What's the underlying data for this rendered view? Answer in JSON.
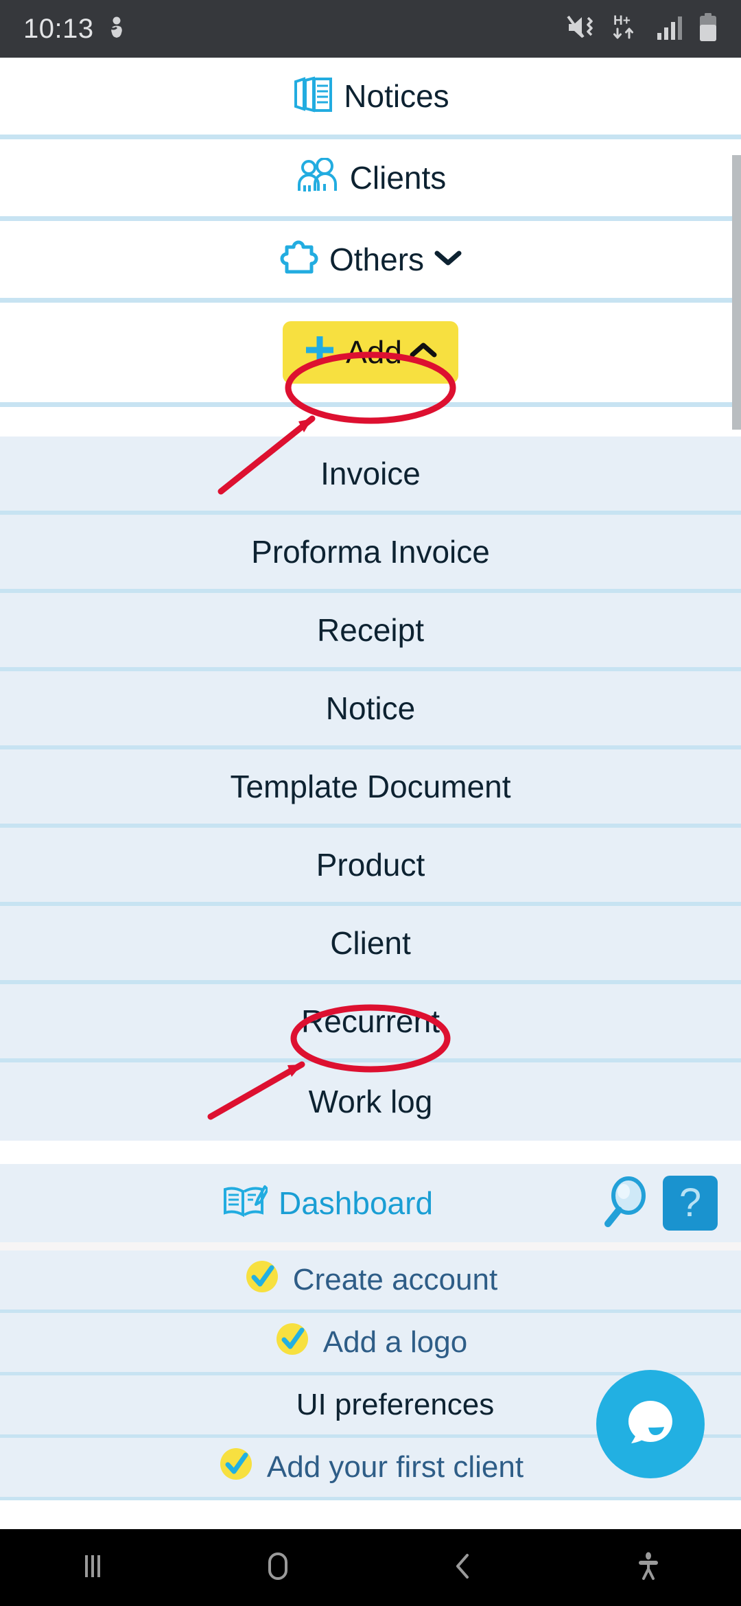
{
  "status_bar": {
    "time": "10:13",
    "left_icons": [
      "do-not-disturb-person-icon"
    ],
    "right_icons": [
      "mute-vibrate-icon",
      "h-plus-data-icon",
      "signal-bars-icon",
      "battery-icon"
    ],
    "background_color": "#36383c",
    "text_color": "#e3e4e6"
  },
  "top_nav": {
    "items": [
      {
        "label": "Notices",
        "icon": "stacked-documents-icon",
        "has_chevron": false
      },
      {
        "label": "Clients",
        "icon": "people-group-icon",
        "has_chevron": false
      },
      {
        "label": "Others",
        "icon": "puzzle-piece-icon",
        "has_chevron": true,
        "chevron": "chevron-down-icon"
      }
    ],
    "add_button": {
      "label": "Add",
      "icon": "plus-icon",
      "chevron": "chevron-up-icon",
      "highlight_color": "#f7e040",
      "expanded": true
    }
  },
  "dropdown": {
    "items": [
      {
        "label": "Invoice"
      },
      {
        "label": "Proforma Invoice"
      },
      {
        "label": "Receipt"
      },
      {
        "label": "Notice"
      },
      {
        "label": "Template Document"
      },
      {
        "label": "Product"
      },
      {
        "label": "Client"
      },
      {
        "label": "Recurrent"
      },
      {
        "label": "Work log"
      }
    ],
    "background_color": "#e7eff7",
    "separator_color": "#c7e3f2"
  },
  "dashboard_bar": {
    "label": "Dashboard",
    "icon": "open-book-pencil-icon",
    "label_color": "#1a9ed4",
    "search_icon": "magnifier-icon",
    "help_label": "?",
    "help_color": "#1a93cf"
  },
  "checklist": {
    "items": [
      {
        "label": "Create account",
        "checked": true
      },
      {
        "label": "Add a logo",
        "checked": true
      },
      {
        "label": "UI preferences",
        "checked": false
      },
      {
        "label": "Add your first client",
        "checked": true
      }
    ],
    "check_badge_color": "#f7e040",
    "check_mark_color": "#22b0e2",
    "checked_text_color": "#2e5d87",
    "unchecked_text_color": "#0d2231"
  },
  "chat_fab": {
    "icon": "chat-bubble-smile-icon",
    "color": "#22b0e2"
  },
  "annotations": {
    "color": "#dd1030",
    "marks": [
      {
        "type": "ellipse",
        "target": "Add"
      },
      {
        "type": "arrow",
        "target": "Add"
      },
      {
        "type": "ellipse",
        "target": "Recurrent"
      },
      {
        "type": "arrow",
        "target": "Recurrent"
      }
    ]
  },
  "bottom_nav": {
    "items": [
      {
        "icon": "recents-icon"
      },
      {
        "icon": "home-icon"
      },
      {
        "icon": "back-icon"
      },
      {
        "icon": "accessibility-icon"
      }
    ],
    "background_color": "#000000",
    "icon_color": "#9a9a9a"
  }
}
